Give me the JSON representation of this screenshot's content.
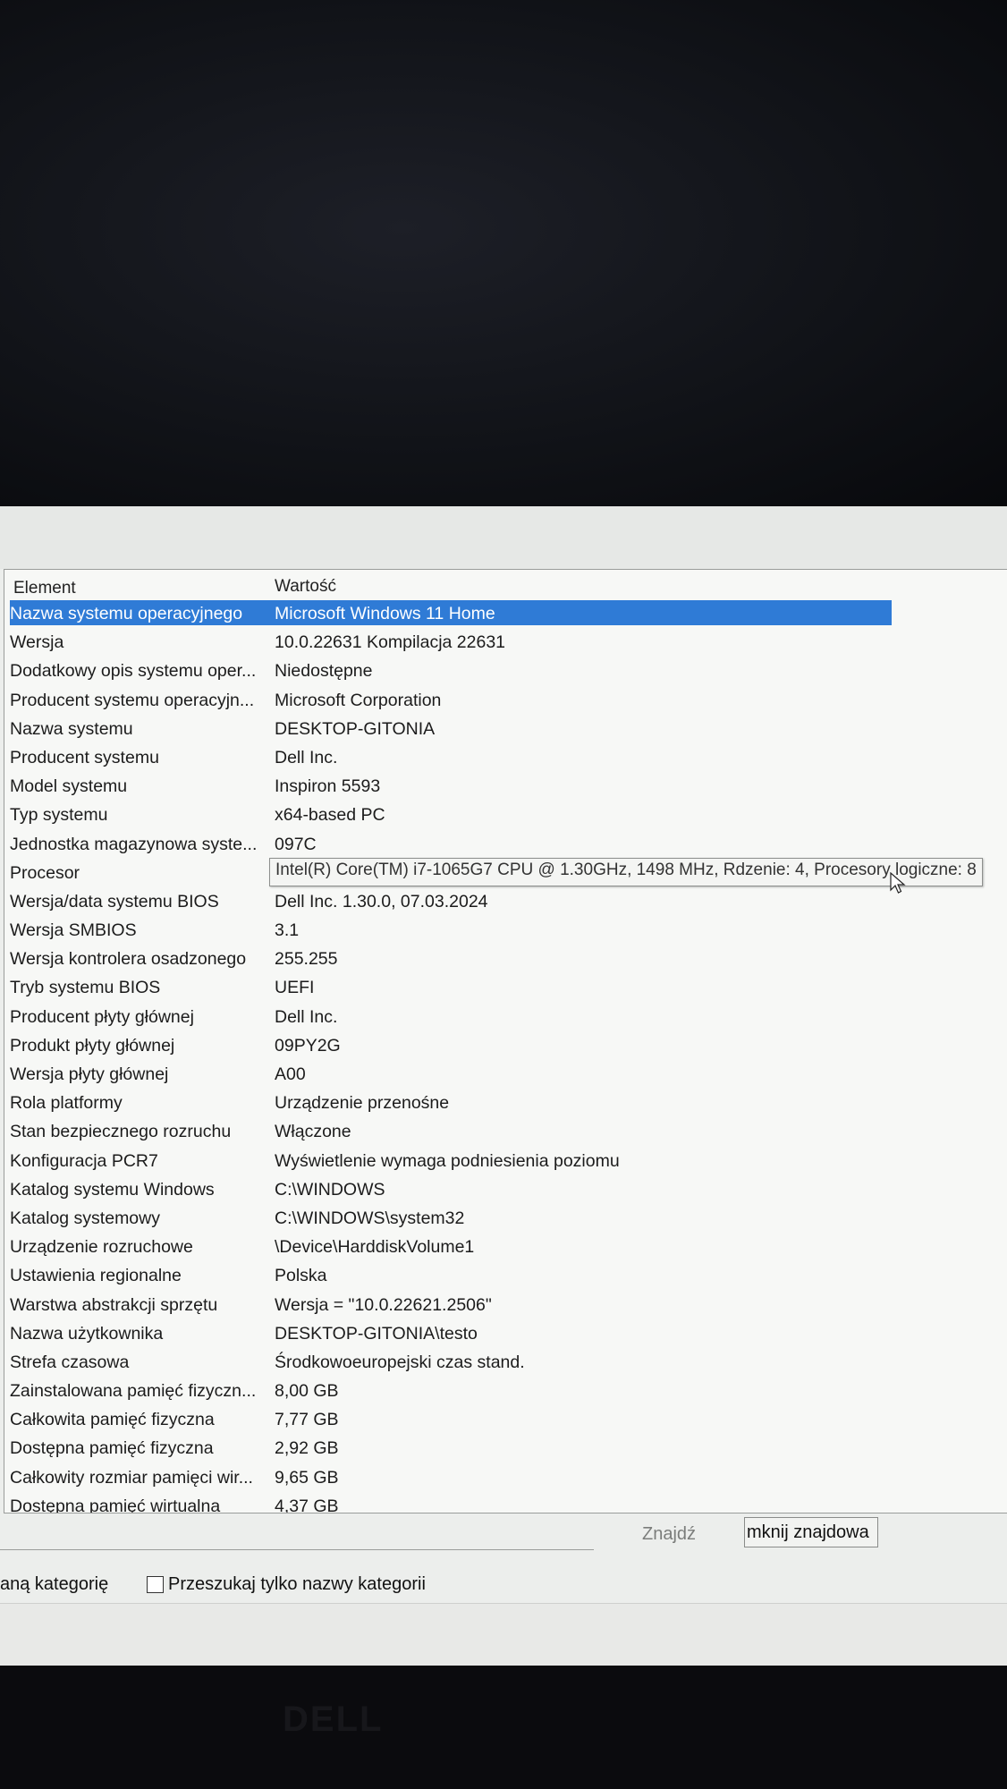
{
  "window": {
    "column_headers": {
      "element": "Element",
      "value": "Wartość"
    },
    "rows": [
      {
        "key": "Nazwa systemu operacyjnego",
        "value": "Microsoft Windows 11 Home"
      },
      {
        "key": "Wersja",
        "value": "10.0.22631 Kompilacja 22631"
      },
      {
        "key": "Dodatkowy opis systemu oper...",
        "value": "Niedostępne"
      },
      {
        "key": "Producent systemu operacyjn...",
        "value": "Microsoft Corporation"
      },
      {
        "key": "Nazwa systemu",
        "value": "DESKTOP-GITONIA"
      },
      {
        "key": "Producent systemu",
        "value": "Dell Inc."
      },
      {
        "key": "Model systemu",
        "value": "Inspiron 5593"
      },
      {
        "key": "Typ systemu",
        "value": "x64-based PC"
      },
      {
        "key": "Jednostka magazynowa syste...",
        "value": "097C"
      },
      {
        "key": "Procesor",
        "value": "Intel(R) Core(TM) i7-1065G7 CPU @ 1.30GHz, 1498 MHz, Rdzenie: 4, Procesory logiczne: 8"
      },
      {
        "key": "Wersja/data systemu BIOS",
        "value": "Dell Inc. 1.30.0, 07.03.2024"
      },
      {
        "key": "Wersja SMBIOS",
        "value": "3.1"
      },
      {
        "key": "Wersja kontrolera osadzonego",
        "value": "255.255"
      },
      {
        "key": "Tryb systemu BIOS",
        "value": "UEFI"
      },
      {
        "key": "Producent płyty głównej",
        "value": "Dell Inc."
      },
      {
        "key": "Produkt płyty głównej",
        "value": "09PY2G"
      },
      {
        "key": "Wersja płyty głównej",
        "value": "A00"
      },
      {
        "key": "Rola platformy",
        "value": "Urządzenie przenośne"
      },
      {
        "key": "Stan bezpiecznego rozruchu",
        "value": "Włączone"
      },
      {
        "key": "Konfiguracja PCR7",
        "value": "Wyświetlenie wymaga podniesienia poziomu"
      },
      {
        "key": "Katalog systemu Windows",
        "value": "C:\\WINDOWS"
      },
      {
        "key": "Katalog systemowy",
        "value": "C:\\WINDOWS\\system32"
      },
      {
        "key": "Urządzenie rozruchowe",
        "value": "\\Device\\HarddiskVolume1"
      },
      {
        "key": "Ustawienia regionalne",
        "value": "Polska"
      },
      {
        "key": "Warstwa abstrakcji sprzętu",
        "value": "Wersja = \"10.0.22621.2506\""
      },
      {
        "key": "Nazwa użytkownika",
        "value": "DESKTOP-GITONIA\\testo"
      },
      {
        "key": "Strefa czasowa",
        "value": "Środkowoeuropejski czas stand."
      },
      {
        "key": "Zainstalowana pamięć fizyczn...",
        "value": "8,00 GB"
      },
      {
        "key": "Całkowita pamięć fizyczna",
        "value": "7,77 GB"
      },
      {
        "key": "Dostępna pamięć fizyczna",
        "value": "2,92 GB"
      },
      {
        "key": "Całkowity rozmiar pamięci wir...",
        "value": "9,65 GB"
      },
      {
        "key": "Dostępna pamięć wirtualna",
        "value": "4,37 GB"
      }
    ],
    "selected_row_index": 0,
    "tooltip_row_index": 9,
    "tooltip_text": "Intel(R) Core(TM) i7-1065G7 CPU @ 1.30GHz, 1498 MHz, Rdzenie: 4, Procesory logiczne: 8",
    "find": {
      "input_value": "",
      "find_button_label": "Znajdź",
      "close_find_button_label": "mknij znajdowa"
    },
    "options": {
      "selected_category_label": "aną kategorię",
      "search_category_names_label": "Przeszukaj tylko nazwy kategorii",
      "search_category_names_checked": false
    },
    "colors": {
      "selection": "#2f7bd6",
      "window_bg": "#f7f8f6",
      "bezel": "#0a0a0e"
    }
  },
  "bezel": {
    "logo": "DELL"
  }
}
